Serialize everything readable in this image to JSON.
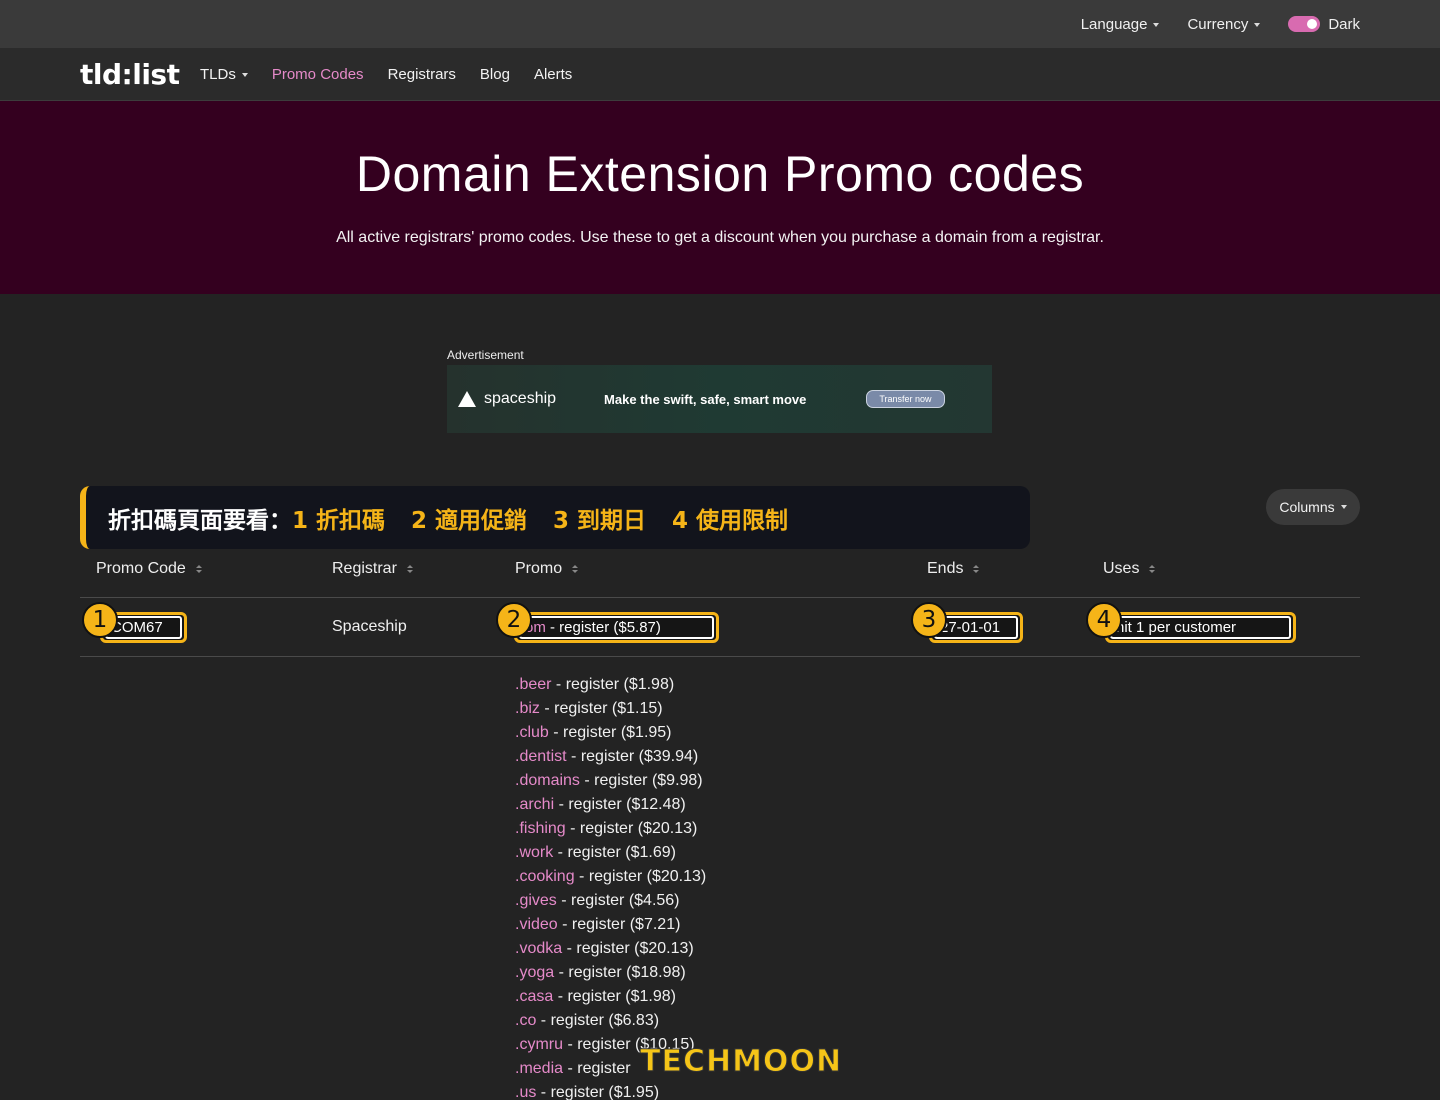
{
  "topbar": {
    "language_label": "Language",
    "currency_label": "Currency",
    "theme_label": "Dark"
  },
  "nav": {
    "logo": "tld:list",
    "tlds": "TLDs",
    "promo_codes": "Promo Codes",
    "registrars": "Registrars",
    "blog": "Blog",
    "alerts": "Alerts"
  },
  "hero": {
    "title": "Domain Extension Promo codes",
    "subtitle": "All active registrars' promo codes. Use these to get a discount when you purchase a domain from a registrar."
  },
  "ad": {
    "label": "Advertisement",
    "brand": "spaceship",
    "slogan": "Make the swift, safe, smart move",
    "cta": "Transfer now"
  },
  "annotation": {
    "prefix": "折扣碼頁面要看：",
    "items": [
      "1 折扣碼",
      "2 適用促銷",
      "3 到期日",
      "4 使用限制"
    ]
  },
  "columns_button": "Columns",
  "table": {
    "headers": [
      "Promo Code",
      "Registrar",
      "Promo",
      "Ends",
      "Uses"
    ],
    "row": {
      "code": "COM67",
      "registrar": "Spaceship",
      "promo_tld": "om",
      "promo_rest": " - register ($5.87)",
      "ends": "27-01-01",
      "uses": "nit 1 per customer"
    },
    "badges": [
      "1",
      "2",
      "3",
      "4"
    ]
  },
  "promos": [
    {
      "tld": ".beer",
      "text": " - register ($1.98)"
    },
    {
      "tld": ".biz",
      "text": " - register ($1.15)"
    },
    {
      "tld": ".club",
      "text": " - register ($1.95)"
    },
    {
      "tld": ".dentist",
      "text": " - register ($39.94)"
    },
    {
      "tld": ".domains",
      "text": " - register ($9.98)"
    },
    {
      "tld": ".archi",
      "text": " - register ($12.48)"
    },
    {
      "tld": ".fishing",
      "text": " - register ($20.13)"
    },
    {
      "tld": ".work",
      "text": " - register ($1.69)"
    },
    {
      "tld": ".cooking",
      "text": " - register ($20.13)"
    },
    {
      "tld": ".gives",
      "text": " - register ($4.56)"
    },
    {
      "tld": ".video",
      "text": " - register ($7.21)"
    },
    {
      "tld": ".vodka",
      "text": " - register ($20.13)"
    },
    {
      "tld": ".yoga",
      "text": " - register ($18.98)"
    },
    {
      "tld": ".casa",
      "text": " - register ($1.98)"
    },
    {
      "tld": ".co",
      "text": " - register ($6.83)"
    },
    {
      "tld": ".cymru",
      "text": " - register ($10.15)"
    },
    {
      "tld": ".media",
      "text": " - register"
    },
    {
      "tld": ".us",
      "text": " - register ($1.95)"
    }
  ],
  "watermark": "TECHMOON",
  "colors": {
    "accent_pink": "#e58ac9",
    "hero_bg": "#34001f",
    "highlight_yellow": "#f5b418"
  }
}
